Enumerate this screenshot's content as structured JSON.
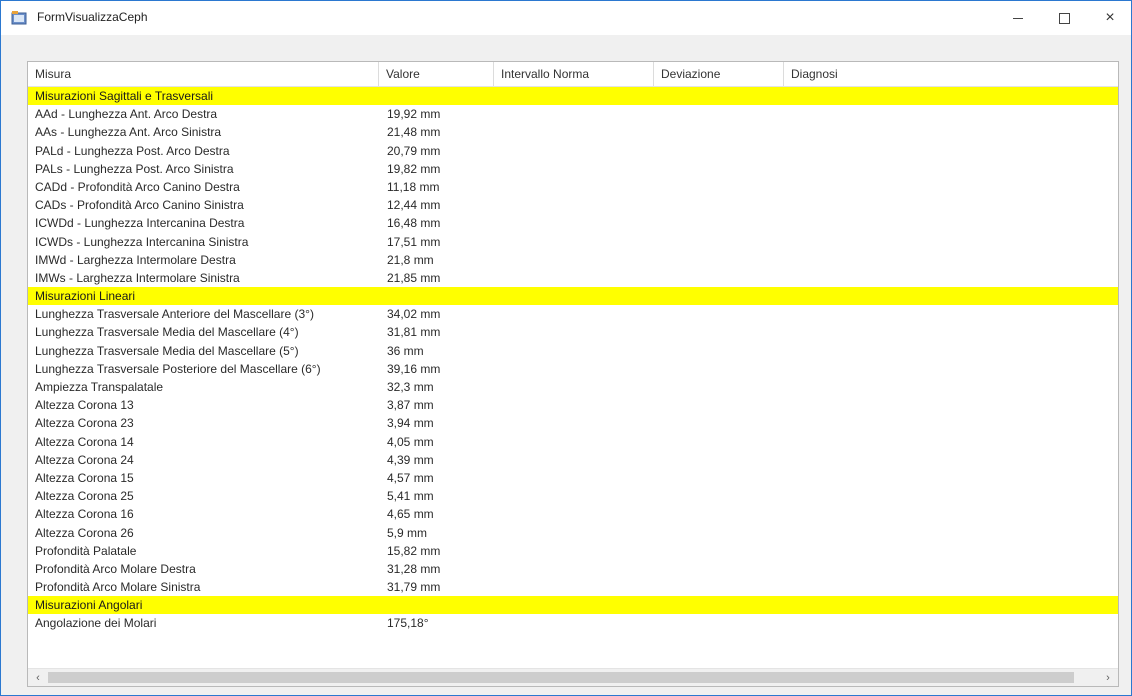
{
  "window": {
    "title": "FormVisualizzaCeph",
    "icon": "form-app-icon",
    "controls": {
      "minimize": "minimize-icon",
      "maximize": "maximize-icon",
      "close": "×"
    }
  },
  "table": {
    "headers": [
      "Misura",
      "Valore",
      "Intervallo Norma",
      "Deviazione",
      "Diagnosi"
    ],
    "rows": [
      {
        "type": "group",
        "misura": "Misurazioni Sagittali e Trasversali",
        "valore": ""
      },
      {
        "type": "item",
        "misura": "AAd - Lunghezza Ant. Arco Destra",
        "valore": "19,92 mm"
      },
      {
        "type": "item",
        "misura": "AAs - Lunghezza Ant. Arco Sinistra",
        "valore": "21,48 mm"
      },
      {
        "type": "item",
        "misura": "PALd - Lunghezza Post. Arco Destra",
        "valore": "20,79 mm"
      },
      {
        "type": "item",
        "misura": "PALs - Lunghezza Post. Arco Sinistra",
        "valore": "19,82 mm"
      },
      {
        "type": "item",
        "misura": "CADd - Profondità Arco Canino Destra",
        "valore": "11,18 mm"
      },
      {
        "type": "item",
        "misura": "CADs - Profondità Arco Canino Sinistra",
        "valore": "12,44 mm"
      },
      {
        "type": "item",
        "misura": "ICWDd - Lunghezza Intercanina Destra",
        "valore": "16,48 mm"
      },
      {
        "type": "item",
        "misura": "ICWDs - Lunghezza Intercanina Sinistra",
        "valore": "17,51 mm"
      },
      {
        "type": "item",
        "misura": "IMWd - Larghezza Intermolare Destra",
        "valore": "21,8 mm"
      },
      {
        "type": "item",
        "misura": "IMWs - Larghezza Intermolare Sinistra",
        "valore": "21,85 mm"
      },
      {
        "type": "group",
        "misura": "Misurazioni Lineari",
        "valore": ""
      },
      {
        "type": "item",
        "misura": "Lunghezza Trasversale Anteriore del Mascellare (3°)",
        "valore": "34,02 mm"
      },
      {
        "type": "item",
        "misura": "Lunghezza Trasversale Media del Mascellare (4°)",
        "valore": "31,81 mm"
      },
      {
        "type": "item",
        "misura": "Lunghezza Trasversale Media del Mascellare (5°)",
        "valore": "36 mm"
      },
      {
        "type": "item",
        "misura": "Lunghezza Trasversale Posteriore del Mascellare (6°)",
        "valore": "39,16 mm"
      },
      {
        "type": "item",
        "misura": "Ampiezza Transpalatale",
        "valore": "32,3 mm"
      },
      {
        "type": "item",
        "misura": "Altezza Corona 13",
        "valore": "3,87 mm"
      },
      {
        "type": "item",
        "misura": "Altezza Corona 23",
        "valore": "3,94 mm"
      },
      {
        "type": "item",
        "misura": "Altezza Corona 14",
        "valore": "4,05 mm"
      },
      {
        "type": "item",
        "misura": "Altezza Corona 24",
        "valore": "4,39 mm"
      },
      {
        "type": "item",
        "misura": "Altezza Corona 15",
        "valore": "4,57 mm"
      },
      {
        "type": "item",
        "misura": "Altezza Corona 25",
        "valore": "5,41 mm"
      },
      {
        "type": "item",
        "misura": "Altezza Corona 16",
        "valore": "4,65 mm"
      },
      {
        "type": "item",
        "misura": "Altezza Corona 26",
        "valore": "5,9 mm"
      },
      {
        "type": "item",
        "misura": "Profondità Palatale",
        "valore": "15,82 mm"
      },
      {
        "type": "item",
        "misura": "Profondità Arco Molare Destra",
        "valore": "31,28 mm"
      },
      {
        "type": "item",
        "misura": "Profondità Arco Molare Sinistra",
        "valore": "31,79 mm"
      },
      {
        "type": "group",
        "misura": "Misurazioni Angolari",
        "valore": ""
      },
      {
        "type": "item",
        "misura": "Angolazione dei Molari",
        "valore": "175,18°"
      }
    ]
  },
  "scrollbar": {
    "left_arrow": "‹",
    "right_arrow": "›"
  },
  "colors": {
    "group_highlight": "#ffff00",
    "window_border": "#2b78d0"
  }
}
